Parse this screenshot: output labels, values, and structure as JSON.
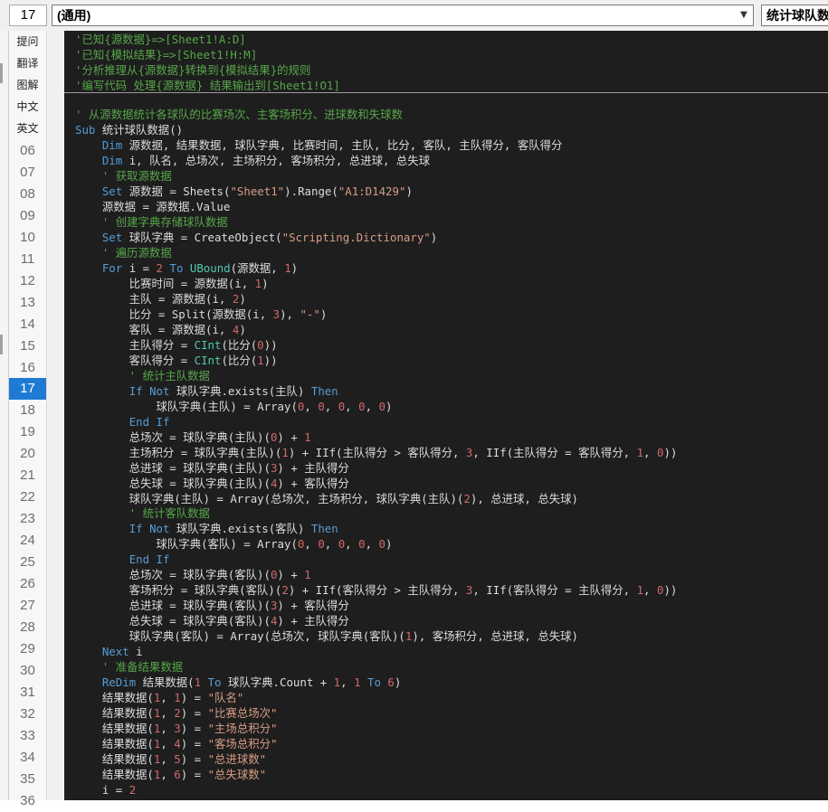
{
  "toolbar": {
    "line_number": "17",
    "left_combo": "(通用)",
    "right_combo": "统计球队数"
  },
  "gutter": {
    "buttons": [
      "提问",
      "翻译",
      "图解",
      "中文",
      "英文"
    ],
    "line_numbers": [
      "06",
      "07",
      "08",
      "09",
      "10",
      "11",
      "12",
      "13",
      "14",
      "15",
      "16",
      "17",
      "18",
      "19",
      "20",
      "21",
      "22",
      "23",
      "24",
      "25",
      "26",
      "27",
      "28",
      "29",
      "30",
      "31",
      "32",
      "33",
      "34",
      "35",
      "36"
    ],
    "active_line": "17"
  },
  "header_comments": [
    "'已知{源数据}=>[Sheet1!A:D]",
    "'已知{模拟结果}=>[Sheet1!H:M]",
    "'分析推理从{源数据}转换到{模拟结果}的规则",
    "'编写代码 处理{源数据} 结果输出到[Sheet1!O1]"
  ],
  "code_lines": [
    [
      [
        "cmt",
        "' 从源数据统计各球队的比赛场次、主客场积分、进球数和失球数"
      ]
    ],
    [
      [
        "kw2",
        "Sub"
      ],
      [
        "id",
        " 统计球队数据()"
      ]
    ],
    [
      [
        "id",
        "    "
      ],
      [
        "kw2",
        "Dim"
      ],
      [
        "id",
        " 源数据, 结果数据, 球队字典, 比赛时间, 主队, 比分, 客队, 主队得分, 客队得分"
      ]
    ],
    [
      [
        "id",
        "    "
      ],
      [
        "kw2",
        "Dim"
      ],
      [
        "id",
        " i, 队名, 总场次, 主场积分, 客场积分, 总进球, 总失球"
      ]
    ],
    [
      [
        "cmt",
        "    ' 获取源数据"
      ]
    ],
    [
      [
        "id",
        "    "
      ],
      [
        "kw2",
        "Set"
      ],
      [
        "id",
        " 源数据 = Sheets("
      ],
      [
        "str",
        "\"Sheet1\""
      ],
      [
        "id",
        ").Range("
      ],
      [
        "str",
        "\"A1:D1429\""
      ],
      [
        "id",
        ")"
      ]
    ],
    [
      [
        "id",
        "    源数据 = 源数据.Value"
      ]
    ],
    [
      [
        "cmt",
        "    ' 创建字典存储球队数据"
      ]
    ],
    [
      [
        "id",
        "    "
      ],
      [
        "kw2",
        "Set"
      ],
      [
        "id",
        " 球队字典 = CreateObject("
      ],
      [
        "str",
        "\"Scripting.Dictionary\""
      ],
      [
        "id",
        ")"
      ]
    ],
    [
      [
        "cmt",
        "    ' 遍历源数据"
      ]
    ],
    [
      [
        "id",
        "    "
      ],
      [
        "kw2",
        "For"
      ],
      [
        "id",
        " i = "
      ],
      [
        "num",
        "2"
      ],
      [
        "id",
        " "
      ],
      [
        "kw2",
        "To"
      ],
      [
        "id",
        " "
      ],
      [
        "kw",
        "UBound"
      ],
      [
        "id",
        "(源数据, "
      ],
      [
        "num",
        "1"
      ],
      [
        "id",
        ")"
      ]
    ],
    [
      [
        "id",
        "        比赛时间 = 源数据(i, "
      ],
      [
        "num",
        "1"
      ],
      [
        "id",
        ")"
      ]
    ],
    [
      [
        "id",
        "        主队 = 源数据(i, "
      ],
      [
        "num",
        "2"
      ],
      [
        "id",
        ")"
      ]
    ],
    [
      [
        "id",
        "        比分 = Split(源数据(i, "
      ],
      [
        "num",
        "3"
      ],
      [
        "id",
        "), "
      ],
      [
        "str",
        "\"-\""
      ],
      [
        "id",
        ")"
      ]
    ],
    [
      [
        "id",
        "        客队 = 源数据(i, "
      ],
      [
        "num",
        "4"
      ],
      [
        "id",
        ")"
      ]
    ],
    [
      [
        "id",
        "        主队得分 = "
      ],
      [
        "kw",
        "CInt"
      ],
      [
        "id",
        "(比分("
      ],
      [
        "num",
        "0"
      ],
      [
        "id",
        "))"
      ]
    ],
    [
      [
        "id",
        "        客队得分 = "
      ],
      [
        "kw",
        "CInt"
      ],
      [
        "id",
        "(比分("
      ],
      [
        "num",
        "1"
      ],
      [
        "id",
        "))"
      ]
    ],
    [
      [
        "cmt",
        "        ' 统计主队数据"
      ]
    ],
    [
      [
        "id",
        "        "
      ],
      [
        "kw2",
        "If Not"
      ],
      [
        "id",
        " 球队字典.exists(主队) "
      ],
      [
        "kw2",
        "Then"
      ]
    ],
    [
      [
        "id",
        "            球队字典(主队) = Array("
      ],
      [
        "num",
        "0"
      ],
      [
        "id",
        ", "
      ],
      [
        "num",
        "0"
      ],
      [
        "id",
        ", "
      ],
      [
        "num",
        "0"
      ],
      [
        "id",
        ", "
      ],
      [
        "num",
        "0"
      ],
      [
        "id",
        ", "
      ],
      [
        "num",
        "0"
      ],
      [
        "id",
        ")"
      ]
    ],
    [
      [
        "id",
        "        "
      ],
      [
        "kw2",
        "End If"
      ]
    ],
    [
      [
        "id",
        "        总场次 = 球队字典(主队)("
      ],
      [
        "num",
        "0"
      ],
      [
        "id",
        ") + "
      ],
      [
        "num",
        "1"
      ]
    ],
    [
      [
        "id",
        "        主场积分 = 球队字典(主队)("
      ],
      [
        "num",
        "1"
      ],
      [
        "id",
        ") + IIf(主队得分 > 客队得分, "
      ],
      [
        "num",
        "3"
      ],
      [
        "id",
        ", IIf(主队得分 = 客队得分, "
      ],
      [
        "num",
        "1"
      ],
      [
        "id",
        ", "
      ],
      [
        "num",
        "0"
      ],
      [
        "id",
        "))"
      ]
    ],
    [
      [
        "id",
        "        总进球 = 球队字典(主队)("
      ],
      [
        "num",
        "3"
      ],
      [
        "id",
        ") + 主队得分"
      ]
    ],
    [
      [
        "id",
        "        总失球 = 球队字典(主队)("
      ],
      [
        "num",
        "4"
      ],
      [
        "id",
        ") + 客队得分"
      ]
    ],
    [
      [
        "id",
        "        球队字典(主队) = Array(总场次, 主场积分, 球队字典(主队)("
      ],
      [
        "num",
        "2"
      ],
      [
        "id",
        "), 总进球, 总失球)"
      ]
    ],
    [
      [
        "cmt",
        "        ' 统计客队数据"
      ]
    ],
    [
      [
        "id",
        "        "
      ],
      [
        "kw2",
        "If Not"
      ],
      [
        "id",
        " 球队字典.exists(客队) "
      ],
      [
        "kw2",
        "Then"
      ]
    ],
    [
      [
        "id",
        "            球队字典(客队) = Array("
      ],
      [
        "num",
        "0"
      ],
      [
        "id",
        ", "
      ],
      [
        "num",
        "0"
      ],
      [
        "id",
        ", "
      ],
      [
        "num",
        "0"
      ],
      [
        "id",
        ", "
      ],
      [
        "num",
        "0"
      ],
      [
        "id",
        ", "
      ],
      [
        "num",
        "0"
      ],
      [
        "id",
        ")"
      ]
    ],
    [
      [
        "id",
        "        "
      ],
      [
        "kw2",
        "End If"
      ]
    ],
    [
      [
        "id",
        "        总场次 = 球队字典(客队)("
      ],
      [
        "num",
        "0"
      ],
      [
        "id",
        ") + "
      ],
      [
        "num",
        "1"
      ]
    ],
    [
      [
        "id",
        "        客场积分 = 球队字典(客队)("
      ],
      [
        "num",
        "2"
      ],
      [
        "id",
        ") + IIf(客队得分 > 主队得分, "
      ],
      [
        "num",
        "3"
      ],
      [
        "id",
        ", IIf(客队得分 = 主队得分, "
      ],
      [
        "num",
        "1"
      ],
      [
        "id",
        ", "
      ],
      [
        "num",
        "0"
      ],
      [
        "id",
        "))"
      ]
    ],
    [
      [
        "id",
        "        总进球 = 球队字典(客队)("
      ],
      [
        "num",
        "3"
      ],
      [
        "id",
        ") + 客队得分"
      ]
    ],
    [
      [
        "id",
        "        总失球 = 球队字典(客队)("
      ],
      [
        "num",
        "4"
      ],
      [
        "id",
        ") + 主队得分"
      ]
    ],
    [
      [
        "id",
        "        球队字典(客队) = Array(总场次, 球队字典(客队)("
      ],
      [
        "num",
        "1"
      ],
      [
        "id",
        "), 客场积分, 总进球, 总失球)"
      ]
    ],
    [
      [
        "id",
        "    "
      ],
      [
        "kw2",
        "Next"
      ],
      [
        "id",
        " i"
      ]
    ],
    [
      [
        "cmt",
        "    ' 准备结果数据"
      ]
    ],
    [
      [
        "id",
        "    "
      ],
      [
        "kw2",
        "ReDim"
      ],
      [
        "id",
        " 结果数据("
      ],
      [
        "num",
        "1"
      ],
      [
        "id",
        " "
      ],
      [
        "kw2",
        "To"
      ],
      [
        "id",
        " 球队字典.Count + "
      ],
      [
        "num",
        "1"
      ],
      [
        "id",
        ", "
      ],
      [
        "num",
        "1"
      ],
      [
        "id",
        " "
      ],
      [
        "kw2",
        "To"
      ],
      [
        "id",
        " "
      ],
      [
        "num",
        "6"
      ],
      [
        "id",
        ")"
      ]
    ],
    [
      [
        "id",
        "    结果数据("
      ],
      [
        "num",
        "1"
      ],
      [
        "id",
        ", "
      ],
      [
        "num",
        "1"
      ],
      [
        "id",
        ") = "
      ],
      [
        "str",
        "\"队名\""
      ]
    ],
    [
      [
        "id",
        "    结果数据("
      ],
      [
        "num",
        "1"
      ],
      [
        "id",
        ", "
      ],
      [
        "num",
        "2"
      ],
      [
        "id",
        ") = "
      ],
      [
        "str",
        "\"比赛总场次\""
      ]
    ],
    [
      [
        "id",
        "    结果数据("
      ],
      [
        "num",
        "1"
      ],
      [
        "id",
        ", "
      ],
      [
        "num",
        "3"
      ],
      [
        "id",
        ") = "
      ],
      [
        "str",
        "\"主场总积分\""
      ]
    ],
    [
      [
        "id",
        "    结果数据("
      ],
      [
        "num",
        "1"
      ],
      [
        "id",
        ", "
      ],
      [
        "num",
        "4"
      ],
      [
        "id",
        ") = "
      ],
      [
        "str",
        "\"客场总积分\""
      ]
    ],
    [
      [
        "id",
        "    结果数据("
      ],
      [
        "num",
        "1"
      ],
      [
        "id",
        ", "
      ],
      [
        "num",
        "5"
      ],
      [
        "id",
        ") = "
      ],
      [
        "str",
        "\"总进球数\""
      ]
    ],
    [
      [
        "id",
        "    结果数据("
      ],
      [
        "num",
        "1"
      ],
      [
        "id",
        ", "
      ],
      [
        "num",
        "6"
      ],
      [
        "id",
        ") = "
      ],
      [
        "str",
        "\"总失球数\""
      ]
    ],
    [
      [
        "id",
        "    i = "
      ],
      [
        "num",
        "2"
      ]
    ]
  ]
}
